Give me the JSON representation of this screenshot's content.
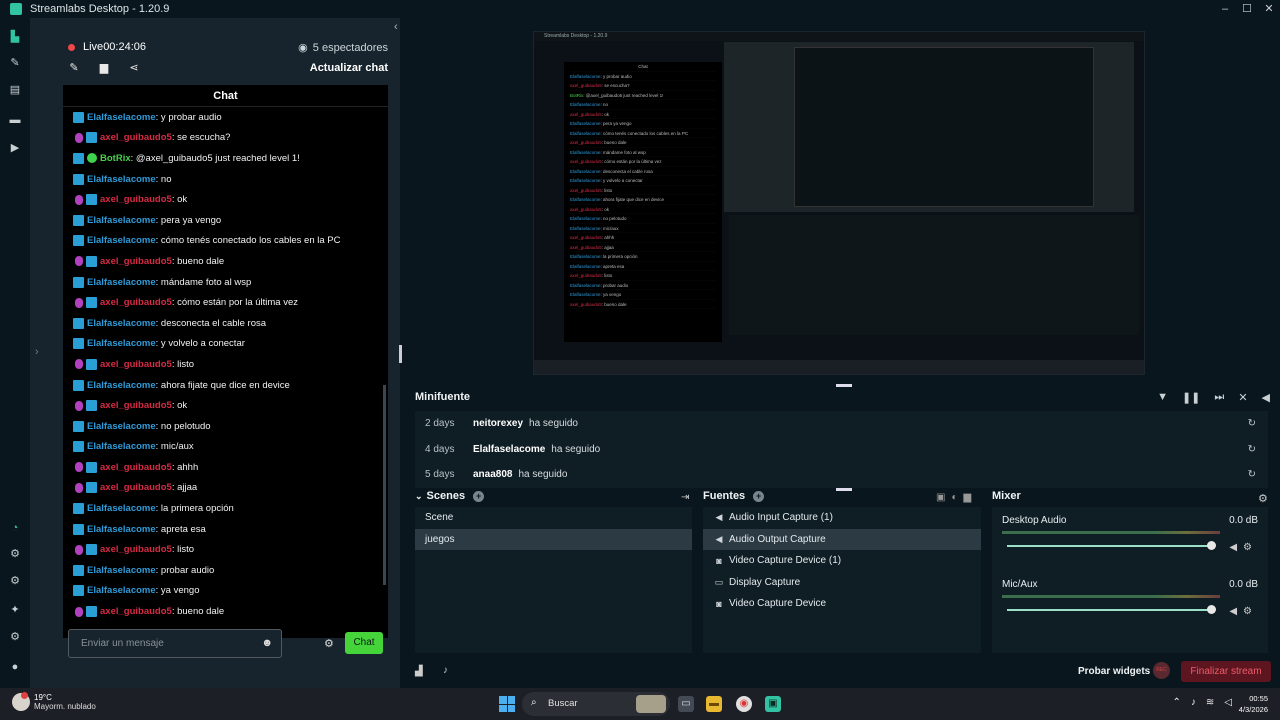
{
  "window": {
    "title": "Streamlabs Desktop - 1.20.9",
    "minimize": "–",
    "maximize": "☐",
    "close": "✕"
  },
  "stream": {
    "live_label": "Live",
    "live_time": "00:24:06",
    "viewers": "5 espectadores",
    "refresh_label": "Actualizar chat"
  },
  "chat": {
    "title": "Chat",
    "input_placeholder": "Enviar un mensaje",
    "send_label": "Chat",
    "messages": [
      {
        "user": "Elalfaselacome",
        "text": ": y probar audio",
        "badge": "none",
        "color": "#2f9bd8"
      },
      {
        "user": "axel_guibaudo5",
        "text": ": se escucha?",
        "badge": "mic",
        "color": "#d62b45"
      },
      {
        "user": "BotRix",
        "text": ": @axel_guibaudo5 just reached level 1!",
        "badge": "bot",
        "color": "#49d04a"
      },
      {
        "user": "Elalfaselacome",
        "text": ": no",
        "badge": "none",
        "color": "#2f9bd8"
      },
      {
        "user": "axel_guibaudo5",
        "text": ": ok",
        "badge": "mic",
        "color": "#d62b45"
      },
      {
        "user": "Elalfaselacome",
        "text": ": pera ya vengo",
        "badge": "none",
        "color": "#2f9bd8"
      },
      {
        "user": "Elalfaselacome",
        "text": ": cómo tenés conectado los cables en la PC",
        "badge": "none",
        "color": "#2f9bd8"
      },
      {
        "user": "axel_guibaudo5",
        "text": ": bueno dale",
        "badge": "mic",
        "color": "#d62b45"
      },
      {
        "user": "Elalfaselacome",
        "text": ": mándame foto al wsp",
        "badge": "none",
        "color": "#2f9bd8"
      },
      {
        "user": "axel_guibaudo5",
        "text": ": cómo están por la última vez",
        "badge": "mic",
        "color": "#d62b45"
      },
      {
        "user": "Elalfaselacome",
        "text": ": desconecta el cable rosa",
        "badge": "none",
        "color": "#2f9bd8"
      },
      {
        "user": "Elalfaselacome",
        "text": ": y volvelo a conectar",
        "badge": "none",
        "color": "#2f9bd8"
      },
      {
        "user": "axel_guibaudo5",
        "text": ": listo",
        "badge": "mic",
        "color": "#d62b45"
      },
      {
        "user": "Elalfaselacome",
        "text": ": ahora fijate que dice en device",
        "badge": "none",
        "color": "#2f9bd8"
      },
      {
        "user": "axel_guibaudo5",
        "text": ": ok",
        "badge": "mic",
        "color": "#d62b45"
      },
      {
        "user": "Elalfaselacome",
        "text": ": no pelotudo",
        "badge": "none",
        "color": "#2f9bd8"
      },
      {
        "user": "Elalfaselacome",
        "text": ": mic/aux",
        "badge": "none",
        "color": "#2f9bd8"
      },
      {
        "user": "axel_guibaudo5",
        "text": ": ahhh",
        "badge": "mic",
        "color": "#d62b45"
      },
      {
        "user": "axel_guibaudo5",
        "text": ": ajjaa",
        "badge": "mic",
        "color": "#d62b45"
      },
      {
        "user": "Elalfaselacome",
        "text": ": la primera opción",
        "badge": "none",
        "color": "#2f9bd8"
      },
      {
        "user": "Elalfaselacome",
        "text": ": apreta esa",
        "badge": "none",
        "color": "#2f9bd8"
      },
      {
        "user": "axel_guibaudo5",
        "text": ": listo",
        "badge": "mic",
        "color": "#d62b45"
      },
      {
        "user": "Elalfaselacome",
        "text": ": probar audio",
        "badge": "none",
        "color": "#2f9bd8"
      },
      {
        "user": "Elalfaselacome",
        "text": ": ya vengo",
        "badge": "none",
        "color": "#2f9bd8"
      },
      {
        "user": "axel_guibaudo5",
        "text": ": bueno dale",
        "badge": "mic",
        "color": "#d62b45"
      }
    ]
  },
  "minifuente": {
    "title": "Minifuente",
    "rows": [
      {
        "time": "2 days",
        "name": "neitorexey",
        "action": "ha seguido"
      },
      {
        "time": "4 days",
        "name": "Elalfaselacome",
        "action": "ha seguido"
      },
      {
        "time": "5 days",
        "name": "anaa808",
        "action": "ha seguido"
      }
    ]
  },
  "scenes": {
    "title": "Scenes",
    "items": [
      "Scene",
      "juegos"
    ],
    "selected": 1
  },
  "sources": {
    "title": "Fuentes",
    "items": [
      {
        "label": "Audio Input Capture (1)",
        "icon": "speaker-icon"
      },
      {
        "label": "Audio Output Capture",
        "icon": "speaker-icon"
      },
      {
        "label": "Video Capture Device (1)",
        "icon": "camera-icon"
      },
      {
        "label": "Display Capture",
        "icon": "monitor-icon"
      },
      {
        "label": "Video Capture Device",
        "icon": "camera-icon"
      }
    ],
    "selected": 1
  },
  "mixer": {
    "title": "Mixer",
    "channels": [
      {
        "name": "Desktop Audio",
        "db": "0.0 dB",
        "level": 1.0
      },
      {
        "name": "Mic/Aux",
        "db": "0.0 dB",
        "level": 1.0
      }
    ]
  },
  "footer": {
    "test_widgets": "Probar widgets",
    "rec_label": "REC",
    "end_stream": "Finalizar stream"
  },
  "taskbar": {
    "temp": "19°C",
    "weather": "Mayorm. nublado",
    "search_placeholder": "Buscar",
    "time": "00:55",
    "date": "4/3/2026"
  },
  "colors": {
    "accent": "#31c3a2",
    "live": "#f04848",
    "end_stream_bg": "#5d1620",
    "send_button": "#45d43a"
  }
}
